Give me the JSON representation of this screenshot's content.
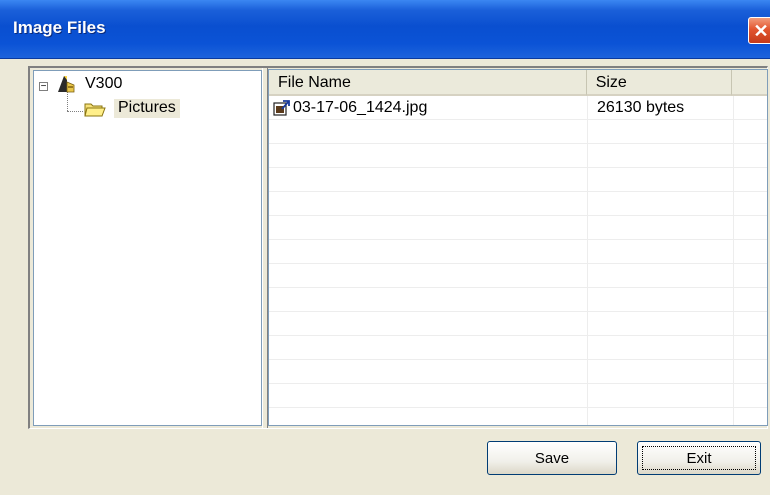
{
  "window": {
    "title": "Image Files",
    "close_glyph": "✕"
  },
  "tree": {
    "root": {
      "label": "V300",
      "expander": "−",
      "icon": "device-icon"
    },
    "child": {
      "label": "Pictures",
      "icon": "folder-icon"
    }
  },
  "list": {
    "columns": [
      "File Name",
      "Size"
    ],
    "rows": [
      {
        "name": "03-17-06_1424.jpg",
        "size": "26130 bytes",
        "icon": "image-file-icon"
      }
    ]
  },
  "buttons": {
    "save_label": "Save",
    "exit_label": "Exit"
  },
  "colors": {
    "titlebar": "#0a4fd0",
    "face": "#ece9d8",
    "close": "#e2552f"
  }
}
